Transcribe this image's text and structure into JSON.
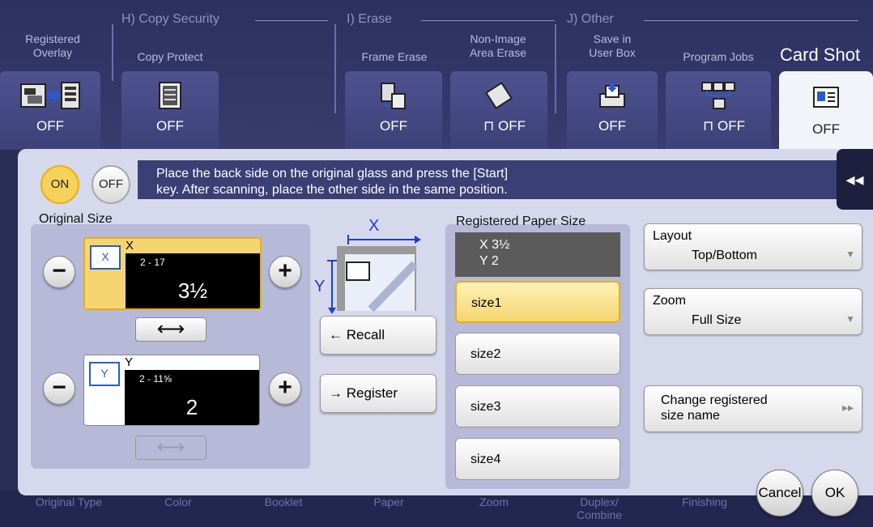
{
  "top": {
    "groups": [
      {
        "id": "H",
        "label": "H)  Copy Security"
      },
      {
        "id": "I",
        "label": "I)  Erase"
      },
      {
        "id": "J",
        "label": "J)  Other"
      }
    ],
    "functions": [
      {
        "label": "Registered\nOverlay",
        "state": "OFF",
        "icon": "overlay-icon"
      },
      {
        "label": "Copy Protect",
        "state": "OFF",
        "icon": "copy-protect-icon"
      },
      {
        "label": "Frame Erase",
        "state": "OFF",
        "icon": "frame-erase-icon"
      },
      {
        "label": "Non-Image\nArea Erase",
        "state": "OFF",
        "icon": "non-image-erase-icon"
      },
      {
        "label": "Save in\nUser Box",
        "state": "OFF",
        "icon": "save-user-box-icon"
      },
      {
        "label": "Program Jobs",
        "state": "OFF",
        "icon": "program-jobs-icon"
      },
      {
        "label": "Card Shot",
        "state": "OFF",
        "icon": "card-shot-icon"
      }
    ]
  },
  "bottom": {
    "items": [
      "Original Type",
      "Color",
      "Booklet",
      "Paper",
      "Zoom",
      "Duplex/\nCombine",
      "Finishing"
    ]
  },
  "panel": {
    "on_label": "ON",
    "off_label": "OFF",
    "message": "Place the back side on the original glass and press the [Start]\nkey. After scanning, place the other side in the same position.",
    "back_label": "◂◂",
    "original_size": {
      "title": "Original Size",
      "x": {
        "axis": "X",
        "range": "2  - 17",
        "value": "3½",
        "icon": "X"
      },
      "y": {
        "axis": "Y",
        "range": "2  - 11⅝",
        "value": "2",
        "icon": "Y"
      },
      "minus": "−",
      "plus": "+",
      "swap": "⟷"
    },
    "diagram": {
      "x_label": "X",
      "y_label": "Y"
    },
    "recall_label": "Recall",
    "register_label": "Register",
    "registered": {
      "title": "Registered Paper Size",
      "readout_x": "X  3½",
      "readout_y": "Y  2",
      "sizes": [
        "size1",
        "size2",
        "size3",
        "size4"
      ],
      "selected_index": 0
    },
    "layout": {
      "label": "Layout",
      "value": "Top/Bottom"
    },
    "zoom": {
      "label": "Zoom",
      "value": "Full Size"
    },
    "change_name": {
      "label": "Change registered\nsize name"
    },
    "cancel_label": "Cancel",
    "ok_label": "OK"
  },
  "colors": {
    "accent": "#f4d56f",
    "panel": "#d6d9eb",
    "topbar": "#2d3160"
  }
}
